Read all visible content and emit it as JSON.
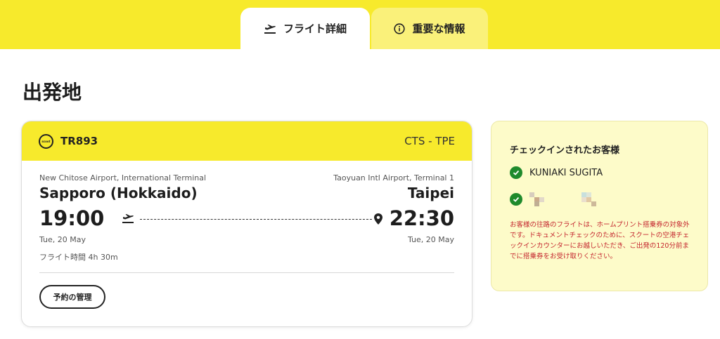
{
  "tabs": [
    {
      "label": "フライト詳細",
      "icon": "plane-departure-icon",
      "active": true
    },
    {
      "label": "重要な情報",
      "icon": "info-icon",
      "active": false
    }
  ],
  "page": {
    "title": "出発地"
  },
  "flight": {
    "logo_text": "scoot",
    "number": "TR893",
    "route": "CTS - TPE",
    "departure": {
      "airport": "New Chitose Airport, International Terminal",
      "city": "Sapporo (Hokkaido)",
      "time": "19:00",
      "date": "Tue, 20 May"
    },
    "arrival": {
      "airport": "Taoyuan Intl Airport, Terminal 1",
      "city": "Taipei",
      "time": "22:30",
      "date": "Tue, 20 May"
    },
    "duration": "フライト時間 4h 30m",
    "manage_label": "予約の管理"
  },
  "checkin": {
    "title": "チェックインされたお客様",
    "passengers": [
      {
        "name": "KUNIAKI SUGITA"
      }
    ],
    "notice": "お客様の往路のフライトは、ホームプリント搭乗券の対象外です。ドキュメントチェックのために、スクートの空港チェックインカウンターにお越しいただき、ご出発の120分前までに搭乗券をお受け取りください。"
  },
  "colors": {
    "brand_yellow": "#f7ea2c",
    "panel_yellow": "#fdfbc9",
    "check_green": "#1f8a2c",
    "notice_red": "#c4262e"
  }
}
